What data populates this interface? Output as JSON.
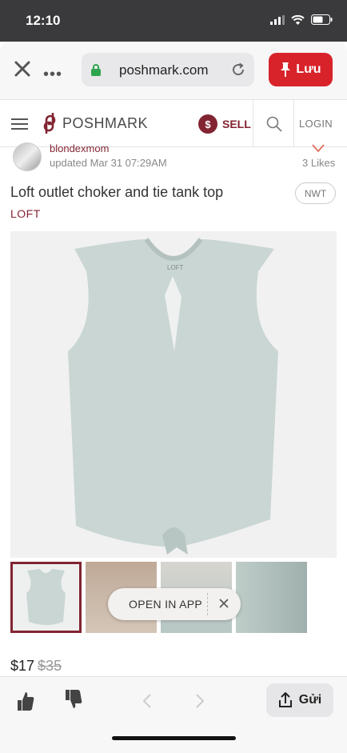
{
  "status_bar": {
    "time": "12:10"
  },
  "browser": {
    "url": "poshmark.com",
    "save_label": "Lưu"
  },
  "nav": {
    "logo_text": "POSHMARK",
    "sell_label": "SELL",
    "sell_icon_text": "$",
    "login_label": "LOGIN"
  },
  "listing": {
    "seller_name": "blondexmom",
    "updated": "updated Mar 31 07:29AM",
    "likes": "3  Likes",
    "title": "Loft outlet choker and tie tank top",
    "condition_badge": "NWT",
    "brand": "LOFT",
    "price": "$17",
    "original_price": "$35",
    "garment_tag": "LOFT"
  },
  "open_app": {
    "label": "OPEN IN APP"
  },
  "toolbar": {
    "share_label": "Gửi"
  },
  "colors": {
    "accent": "#822432",
    "save_red": "#d8232a",
    "garment": "#c9d6d3"
  }
}
